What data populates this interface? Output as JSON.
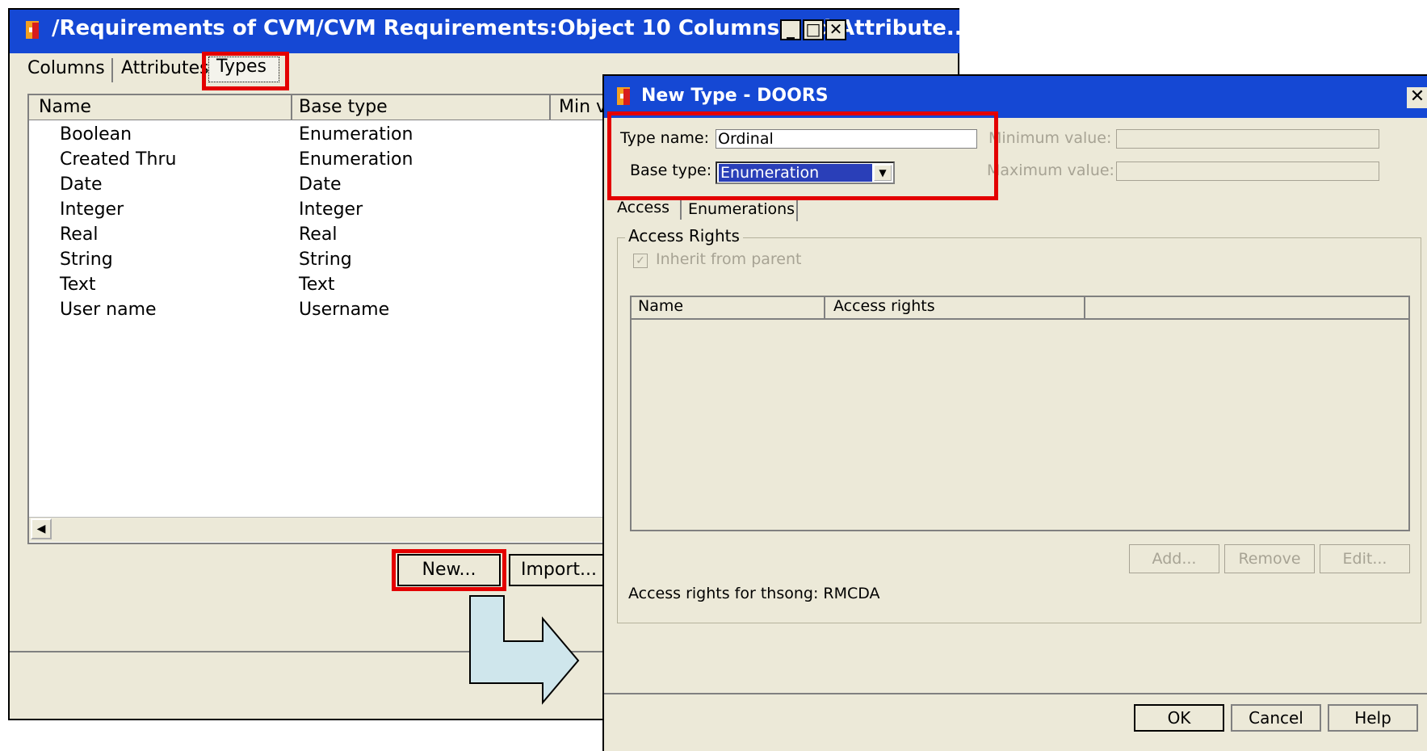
{
  "main_window": {
    "title": "/Requirements of CVM/CVM Requirements:Object 10 Columns and Attribute...",
    "window_buttons": {
      "minimize": "_",
      "maximize": "□",
      "close": "✕"
    },
    "tabs": [
      {
        "label": "Columns"
      },
      {
        "label": "Attributes"
      },
      {
        "label": "Types",
        "selected": true
      }
    ],
    "table": {
      "columns": [
        "Name",
        "Base type",
        "Min v"
      ],
      "rows": [
        {
          "name": "Boolean",
          "base_type": "Enumeration"
        },
        {
          "name": "Created Thru",
          "base_type": "Enumeration"
        },
        {
          "name": "Date",
          "base_type": "Date"
        },
        {
          "name": "Integer",
          "base_type": "Integer"
        },
        {
          "name": "Real",
          "base_type": "Real"
        },
        {
          "name": "String",
          "base_type": "String"
        },
        {
          "name": "Text",
          "base_type": "Text"
        },
        {
          "name": "User name",
          "base_type": "Username"
        }
      ]
    },
    "buttons": {
      "new": "New...",
      "import": "Import..."
    }
  },
  "dialog": {
    "title": "New Type - DOORS",
    "type_name_label": "Type name:",
    "type_name_value": "Ordinal",
    "base_type_label": "Base type:",
    "base_type_value": "Enumeration",
    "min_value_label": "Minimum value:",
    "max_value_label": "Maximum value:",
    "tabs": [
      {
        "label": "Access",
        "selected": true
      },
      {
        "label": "Enumerations"
      }
    ],
    "access_rights_group": "Access Rights",
    "inherit_label": "Inherit from parent",
    "inherit_checked": true,
    "access_columns": [
      "Name",
      "Access rights"
    ],
    "buttons": {
      "add": "Add...",
      "remove": "Remove",
      "edit": "Edit..."
    },
    "access_rights_text": "Access rights for thsong: RMCDA",
    "footer": {
      "ok": "OK",
      "cancel": "Cancel",
      "help": "Help"
    }
  },
  "colors": {
    "titlebar": "#1548d4",
    "highlight": "#e30000",
    "arrow_fill": "#cfe6ec",
    "window_bg": "#ece9d8"
  },
  "icons": [
    "app-icon",
    "minimize-icon",
    "maximize-icon",
    "close-icon",
    "checkbox-icon",
    "dropdown-arrow-icon",
    "scroll-left-icon",
    "flow-arrow-icon"
  ]
}
